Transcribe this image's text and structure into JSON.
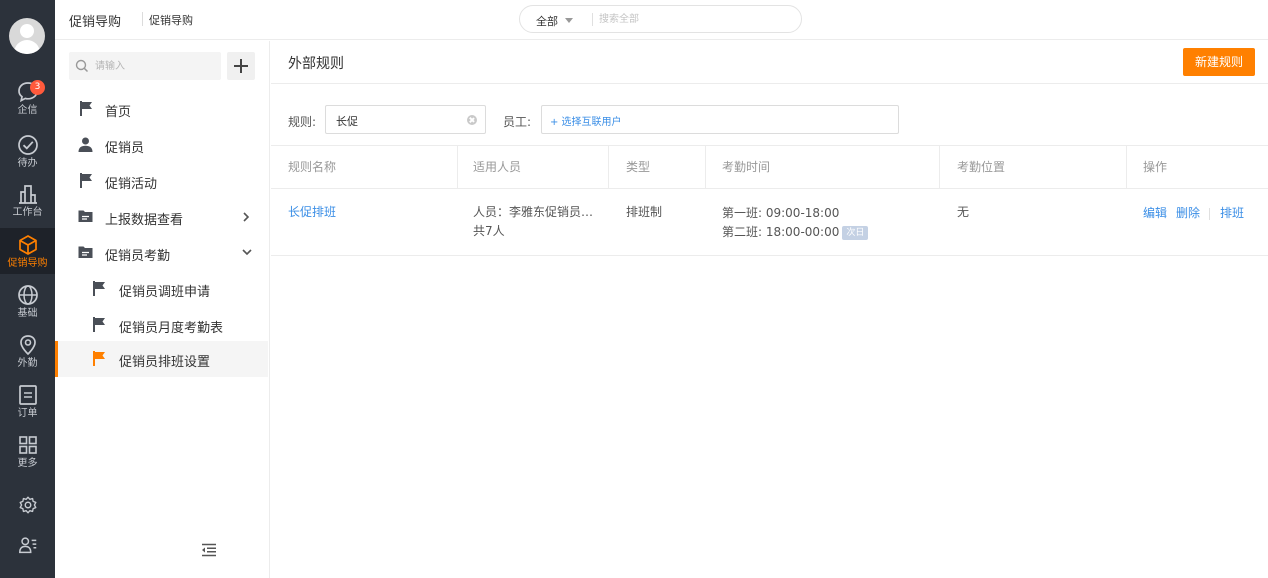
{
  "rail": {
    "items": [
      {
        "label": "企信",
        "icon": "chat-bubble-icon",
        "badge": "3"
      },
      {
        "label": "待办",
        "icon": "check-circle-icon"
      },
      {
        "label": "工作台",
        "icon": "workbench-icon"
      },
      {
        "label": "促销导购",
        "icon": "cube-icon",
        "active": true
      },
      {
        "label": "基础",
        "icon": "globe-icon"
      },
      {
        "label": "外勤",
        "icon": "location-pin-icon"
      },
      {
        "label": "订单",
        "icon": "order-doc-icon"
      },
      {
        "label": "更多",
        "icon": "grid-icon"
      }
    ],
    "accent_color": "#ff8000"
  },
  "topbar": {
    "breadcrumb_main": "促销导购",
    "breadcrumb_sub": "促销导购",
    "search_scope": "全部",
    "search_placeholder": "搜索全部"
  },
  "sidebar": {
    "search_placeholder": "请输入",
    "items": [
      {
        "label": "首页"
      },
      {
        "label": "促销员"
      },
      {
        "label": "促销活动"
      },
      {
        "label": "上报数据查看"
      },
      {
        "label": "促销员考勤"
      },
      {
        "label": "促销员调班申请"
      },
      {
        "label": "促销员月度考勤表"
      },
      {
        "label": "促销员排班设置"
      }
    ]
  },
  "main": {
    "title": "外部规则",
    "new_button": "新建规则",
    "filters": {
      "rule_label": "规则:",
      "rule_value": "长促",
      "staff_label": "员工:",
      "staff_pick": "+ 选择互联用户"
    },
    "table": {
      "headers": [
        "规则名称",
        "适用人员",
        "类型",
        "考勤时间",
        "考勤位置",
        "操作"
      ],
      "rows": [
        {
          "name": "长促排班",
          "people_line1": "人员：李雅东促销员…",
          "people_line2": "共7人",
          "type": "排班制",
          "time_line1": "第一班: 09:00-18:00",
          "time_line2": "第二班: 18:00-00:00",
          "time_tag": "次日",
          "location": "无",
          "actions": [
            "编辑",
            "删除",
            "排班"
          ]
        }
      ]
    }
  }
}
